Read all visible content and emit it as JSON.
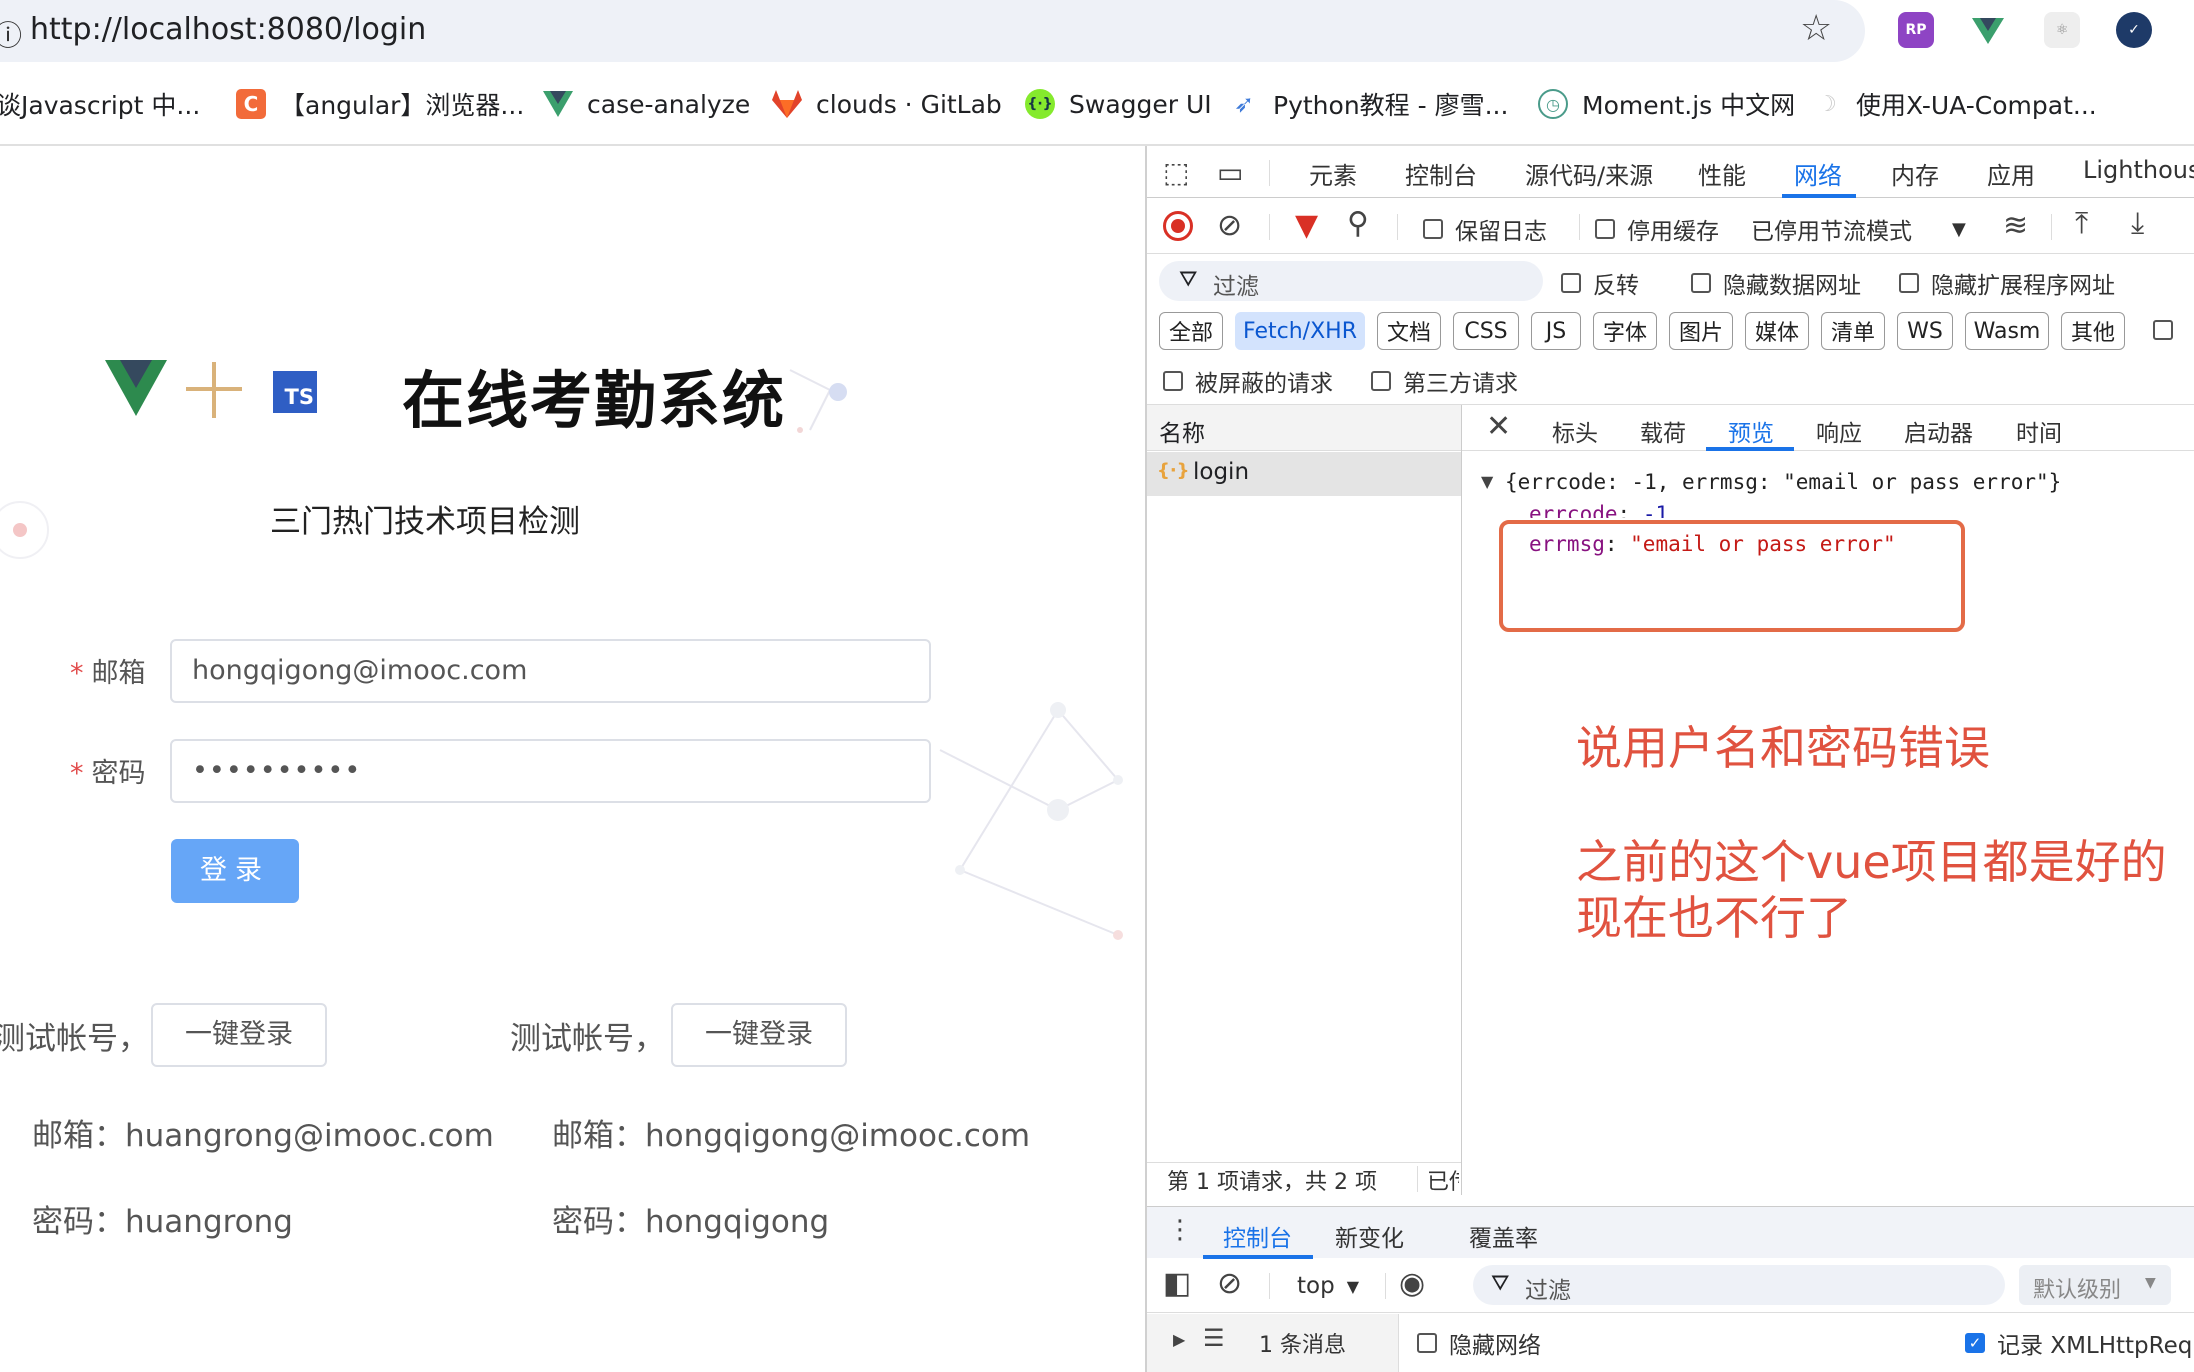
{
  "browser": {
    "url": "http://localhost:8080/login",
    "bookmarks": [
      {
        "label": "谈Javascript 中...",
        "icon": "blank"
      },
      {
        "label": "【angular】浏览器...",
        "icon": "c-orange-icon"
      },
      {
        "label": "case-analyze",
        "icon": "vue-icon"
      },
      {
        "label": "clouds · GitLab",
        "icon": "gitlab-icon"
      },
      {
        "label": "Swagger UI",
        "icon": "swagger-icon"
      },
      {
        "label": "Python教程 - 廖雪...",
        "icon": "rocket-icon"
      },
      {
        "label": "Moment.js 中文网",
        "icon": "clock-icon"
      },
      {
        "label": "使用X-UA-Compat...",
        "icon": "ghost-icon"
      }
    ],
    "extensions": [
      "rp-icon",
      "vue-devtools-icon",
      "react-icon",
      "check-icon"
    ]
  },
  "page": {
    "title": "在线考勤系统",
    "subtitle": "三门热门技术项目检测",
    "ts_badge": "TS",
    "form": {
      "email_label": "邮箱",
      "email_value": "hongqigong@imooc.com",
      "password_label": "密码",
      "password_value": "••••••••••",
      "required_mark": "*",
      "login_button": "登录"
    },
    "test_accounts": [
      {
        "label": "测试帐号，",
        "button": "一键登录",
        "email": "邮箱：huangrong@imooc.com",
        "password": "密码：huangrong"
      },
      {
        "label": "测试帐号，",
        "button": "一键登录",
        "email": "邮箱：hongqigong@imooc.com",
        "password": "密码：hongqigong"
      }
    ]
  },
  "devtools": {
    "tabs": [
      "元素",
      "控制台",
      "源代码/来源",
      "性能",
      "网络",
      "内存",
      "应用",
      "Lighthouse"
    ],
    "active_tab": "网络",
    "toolbar": {
      "preserve_log": "保留日志",
      "disable_cache": "停用缓存",
      "throttle": "已停用节流模式"
    },
    "filter": {
      "placeholder": "过滤",
      "invert": "反转",
      "hide_data_urls": "隐藏数据网址",
      "hide_ext_urls": "隐藏扩展程序网址"
    },
    "type_filters": [
      "全部",
      "Fetch/XHR",
      "文档",
      "CSS",
      "JS",
      "字体",
      "图片",
      "媒体",
      "清单",
      "WS",
      "Wasm",
      "其他"
    ],
    "active_type": "Fetch/XHR",
    "blocked_requests": "被屏蔽的请求",
    "third_party": "第三方请求",
    "name_header": "名称",
    "request_name": "login",
    "detail_tabs": [
      "标头",
      "载荷",
      "预览",
      "响应",
      "启动器",
      "时间"
    ],
    "active_detail": "预览",
    "preview": {
      "summary": "{errcode: -1, errmsg: \"email or pass error\"}",
      "errcode_key": "errcode",
      "errcode_val": "-1",
      "errmsg_key": "errmsg",
      "errmsg_val": "\"email or pass error\""
    },
    "status_bar": "第 1 项请求，共 2 项",
    "status_bar_cut": "已传",
    "drawer_tabs": [
      "控制台",
      "新变化",
      "覆盖率"
    ],
    "console": {
      "context": "top",
      "filter": "过滤",
      "level": "默认级别",
      "messages": "1 条消息",
      "hide_network": "隐藏网络",
      "log_xhr": "记录 XMLHttpRequ"
    },
    "colors": {
      "accent": "#1a73e8",
      "annotation": "#e0523f",
      "string": "#c41a16",
      "key": "#881280"
    }
  },
  "annotations": {
    "line1": "说用户名和密码错误",
    "line2": "之前的这个vue项目都是好的",
    "line3": "现在也不行了"
  }
}
